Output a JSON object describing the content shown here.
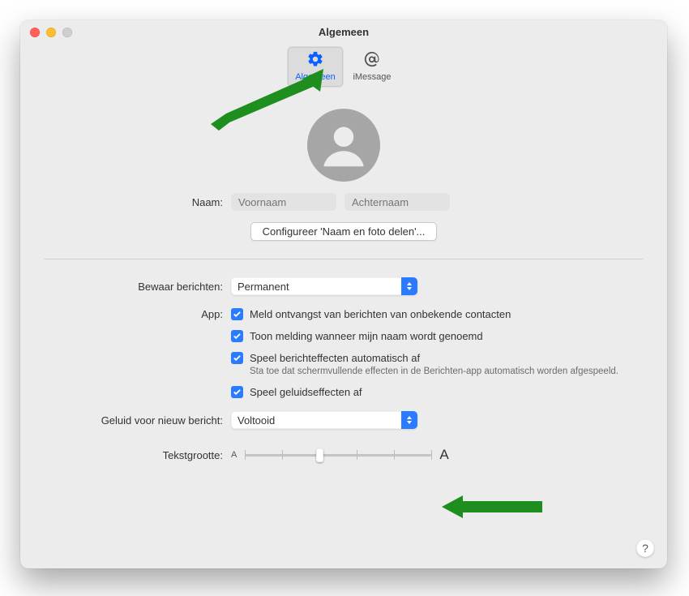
{
  "window": {
    "title": "Algemeen"
  },
  "tabs": {
    "general": {
      "label": "Algemeen"
    },
    "imessage": {
      "label": "iMessage"
    }
  },
  "profile": {
    "name_label": "Naam:",
    "first_placeholder": "Voornaam",
    "last_placeholder": "Achternaam",
    "configure_button": "Configureer 'Naam en foto delen'..."
  },
  "keep_messages": {
    "label": "Bewaar berichten:",
    "value": "Permanent"
  },
  "app_section": {
    "label": "App:",
    "opt1": "Meld ontvangst van berichten van onbekende contacten",
    "opt2": "Toon melding wanneer mijn naam wordt genoemd",
    "opt3": "Speel berichteffecten automatisch af",
    "opt3_sub": "Sta toe dat schermvullende effecten in de Berichten-app automatisch worden afgespeeld.",
    "opt4": "Speel geluidseffecten af"
  },
  "sound": {
    "label": "Geluid voor nieuw bericht:",
    "value": "Voltooid"
  },
  "text_size": {
    "label": "Tekstgrootte:",
    "small_A": "A",
    "big_A": "A"
  },
  "help": "?"
}
